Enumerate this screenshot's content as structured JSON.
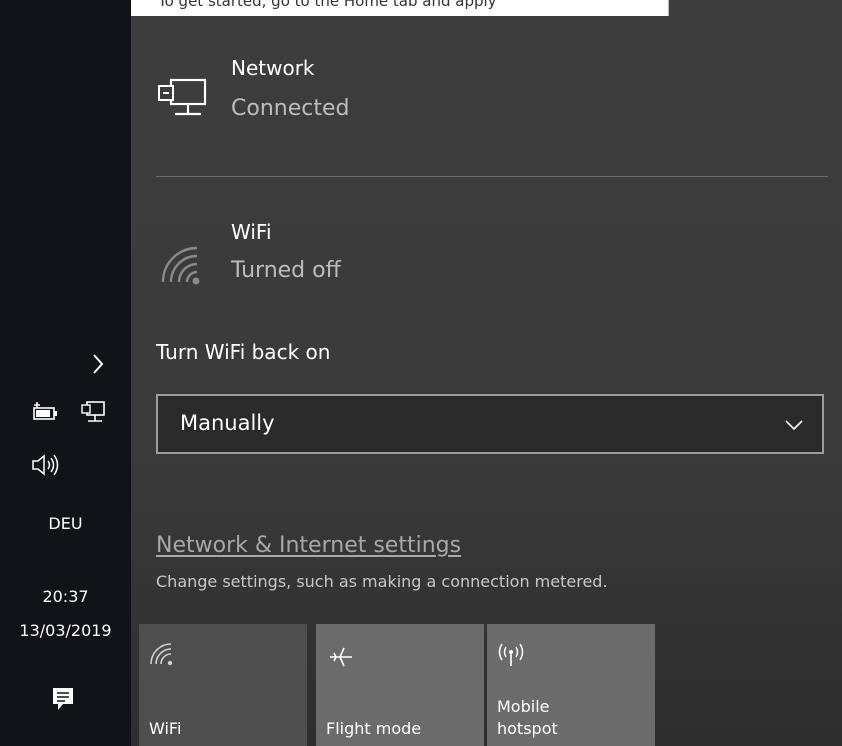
{
  "top_strip": {
    "text": "To get started, go to the Home tab and apply"
  },
  "taskbar": {
    "chevron_icon": "chevron-right-icon",
    "language": "DEU",
    "time": "20:37",
    "date": "13/03/2019"
  },
  "network": {
    "name": "Network",
    "status": "Connected",
    "icon": "ethernet-monitor-icon"
  },
  "wifi": {
    "name": "WiFi",
    "status": "Turned off",
    "icon": "wifi-icon"
  },
  "turn_wifi_on": {
    "label": "Turn WiFi back on",
    "selected": "Manually"
  },
  "settings": {
    "link": "Network & Internet settings",
    "description": "Change settings, such as making a connection metered."
  },
  "quick_actions": [
    {
      "label": "WiFi",
      "icon": "wifi-icon"
    },
    {
      "label": "Flight mode",
      "icon": "airplane-icon"
    },
    {
      "label": "Mobile\nhotspot",
      "icon": "hotspot-icon"
    }
  ],
  "colors": {
    "taskbar_bg": "#101317",
    "flyout_bg": "#3d3d3d",
    "tile_bg": "#6b6b6b",
    "tile_off_bg": "#4e4e4e",
    "muted_text": "#bdbdbd"
  }
}
